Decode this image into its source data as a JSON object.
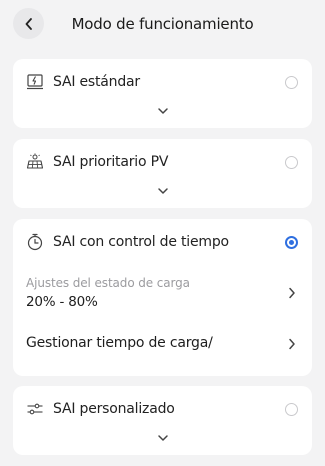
{
  "header": {
    "title": "Modo de funcionamiento",
    "back_icon": "chevron-left-icon"
  },
  "modes": [
    {
      "label": "SAI estándar",
      "icon": "ups-standard-icon",
      "selected": false,
      "expanded": false
    },
    {
      "label": "SAI prioritario PV",
      "icon": "solar-panel-icon",
      "selected": false,
      "expanded": false
    },
    {
      "label": "SAI con control de tiempo",
      "icon": "timer-icon",
      "selected": true,
      "expanded": true,
      "settings": {
        "charge_state_label": "Ajustes del estado de carga",
        "charge_state_value": "20% - 80%",
        "manage_time_label": "Gestionar tiempo de carga/"
      }
    },
    {
      "label": "SAI personalizado",
      "icon": "sliders-icon",
      "selected": false,
      "expanded": false
    }
  ],
  "colors": {
    "accent": "#2f6fe0",
    "background": "#f3f3f4",
    "card": "#ffffff"
  }
}
